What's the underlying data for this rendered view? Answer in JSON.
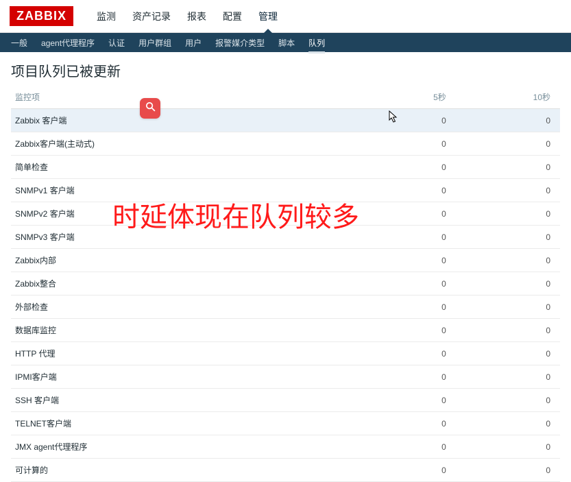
{
  "brand": "ZABBIX",
  "topNav": {
    "items": [
      {
        "label": "监测"
      },
      {
        "label": "资产记录"
      },
      {
        "label": "报表"
      },
      {
        "label": "配置"
      },
      {
        "label": "管理"
      }
    ],
    "activeIndex": 4
  },
  "subNav": {
    "items": [
      {
        "label": "一般"
      },
      {
        "label": "agent代理程序"
      },
      {
        "label": "认证"
      },
      {
        "label": "用户群组"
      },
      {
        "label": "用户"
      },
      {
        "label": "报警媒介类型"
      },
      {
        "label": "脚本"
      },
      {
        "label": "队列"
      }
    ],
    "activeIndex": 7
  },
  "pageTitle": "项目队列已被更新",
  "table": {
    "headers": {
      "monitor": "监控项",
      "fiveSec": "5秒",
      "tenSec": "10秒"
    },
    "rows": [
      {
        "name": "Zabbix 客户端",
        "v5": "0",
        "v10": "0",
        "highlighted": true
      },
      {
        "name": "Zabbix客户端(主动式)",
        "v5": "0",
        "v10": "0"
      },
      {
        "name": "简单检查",
        "v5": "0",
        "v10": "0"
      },
      {
        "name": "SNMPv1 客户端",
        "v5": "0",
        "v10": "0"
      },
      {
        "name": "SNMPv2 客户端",
        "v5": "0",
        "v10": "0"
      },
      {
        "name": "SNMPv3 客户端",
        "v5": "0",
        "v10": "0"
      },
      {
        "name": "Zabbix内部",
        "v5": "0",
        "v10": "0"
      },
      {
        "name": "Zabbix整合",
        "v5": "0",
        "v10": "0"
      },
      {
        "name": "外部检查",
        "v5": "0",
        "v10": "0"
      },
      {
        "name": "数据库监控",
        "v5": "0",
        "v10": "0"
      },
      {
        "name": "HTTP 代理",
        "v5": "0",
        "v10": "0"
      },
      {
        "name": "IPMI客户端",
        "v5": "0",
        "v10": "0"
      },
      {
        "name": "SSH 客户端",
        "v5": "0",
        "v10": "0"
      },
      {
        "name": "TELNET客户端",
        "v5": "0",
        "v10": "0"
      },
      {
        "name": "JMX agent代理程序",
        "v5": "0",
        "v10": "0"
      },
      {
        "name": "可计算的",
        "v5": "0",
        "v10": "0"
      }
    ]
  },
  "annotation": "时延体现在队列较多"
}
